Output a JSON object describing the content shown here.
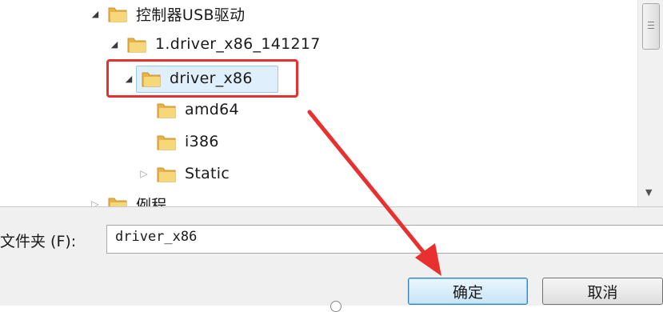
{
  "tree": {
    "items": [
      {
        "label": "控制器USB驱动",
        "state": "expanded"
      },
      {
        "label": "1.driver_x86_141217",
        "state": "expanded"
      },
      {
        "label": "driver_x86",
        "state": "expanded",
        "selected": true
      },
      {
        "label": "amd64",
        "state": "leaf"
      },
      {
        "label": "i386",
        "state": "leaf"
      },
      {
        "label": "Static",
        "state": "collapsed"
      },
      {
        "label": "例程",
        "state": "collapsed"
      }
    ]
  },
  "folder_field": {
    "label": "文件夹 (F):",
    "value": "driver_x86"
  },
  "buttons": {
    "ok": "确定",
    "cancel": "取消"
  },
  "colors": {
    "highlight_box": "#e8302f",
    "arrow": "#e8302f",
    "selection_bg": "#dfeffc",
    "folder_icon": "#e6b34a"
  },
  "icons": {
    "folder": "folder-icon",
    "expanded": "triangle-down-icon",
    "collapsed": "triangle-right-icon"
  }
}
